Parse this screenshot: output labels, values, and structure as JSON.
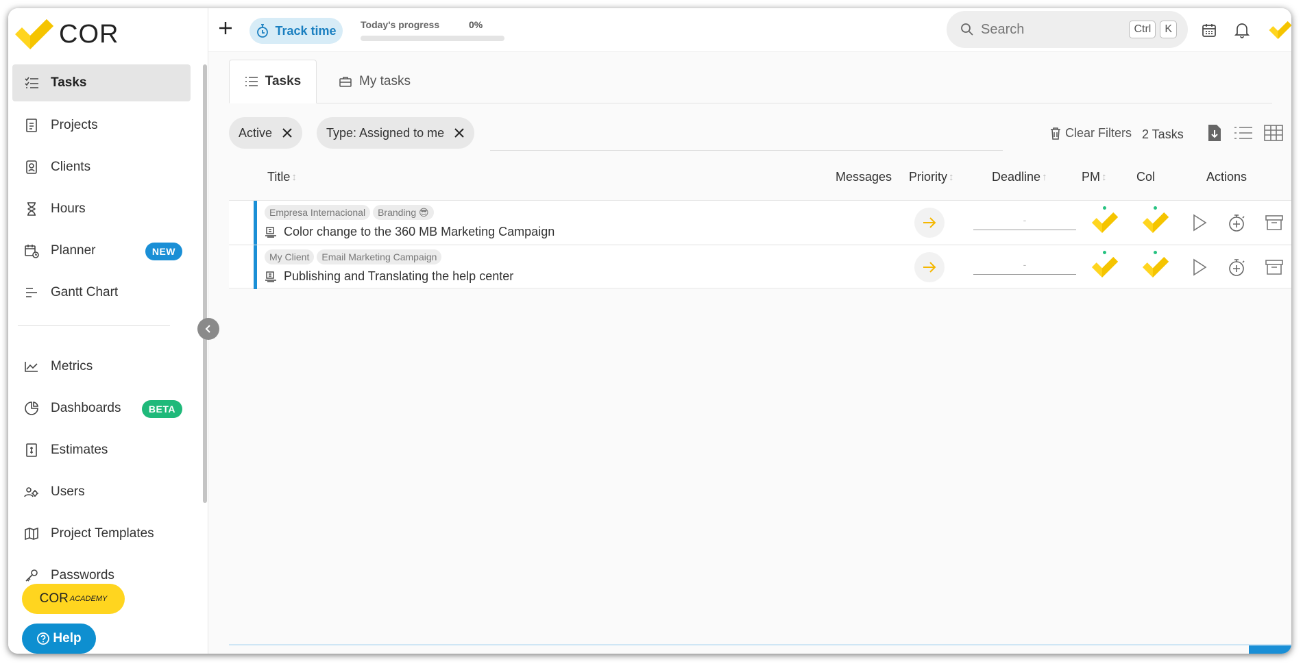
{
  "app": {
    "logo_text": "COR",
    "brand_color": "#ffd51f",
    "accent_color": "#1a8fd6"
  },
  "sidebar": {
    "items": [
      {
        "label": "Tasks",
        "icon": "tasks-icon",
        "active": true
      },
      {
        "label": "Projects",
        "icon": "projects-icon"
      },
      {
        "label": "Clients",
        "icon": "clients-icon"
      },
      {
        "label": "Hours",
        "icon": "hourglass-icon"
      },
      {
        "label": "Planner",
        "icon": "planner-icon",
        "badge": "NEW"
      },
      {
        "label": "Gantt Chart",
        "icon": "gantt-icon"
      },
      {
        "label": "Metrics",
        "icon": "metrics-icon"
      },
      {
        "label": "Dashboards",
        "icon": "dashboards-icon",
        "badge": "BETA"
      },
      {
        "label": "Estimates",
        "icon": "estimates-icon"
      },
      {
        "label": "Users",
        "icon": "users-icon"
      },
      {
        "label": "Project Templates",
        "icon": "map-icon"
      },
      {
        "label": "Passwords",
        "icon": "key-icon"
      }
    ],
    "academy_label": "COR",
    "academy_sub": "ACADEMY",
    "help_label": "Help"
  },
  "topbar": {
    "track_time": "Track time",
    "progress_label": "Today's progress",
    "progress_value": "0%",
    "progress_fraction": 0,
    "search_placeholder": "Search",
    "shortcut_ctrl": "Ctrl",
    "shortcut_k": "K"
  },
  "tabs": [
    {
      "label": "Tasks",
      "active": true
    },
    {
      "label": "My tasks"
    }
  ],
  "filters": {
    "chips": [
      "Active",
      "Type: Assigned to me"
    ],
    "clear_label": "Clear Filters",
    "count_label": "2 Tasks"
  },
  "table": {
    "headers": {
      "title": "Title",
      "messages": "Messages",
      "priority": "Priority",
      "deadline": "Deadline",
      "pm": "PM",
      "col": "Col",
      "actions": "Actions"
    },
    "rows": [
      {
        "tags": [
          "Empresa Internacional",
          "Branding 😎"
        ],
        "title": "Color change to the 360 MB Marketing Campaign",
        "deadline": "-"
      },
      {
        "tags": [
          "My Client",
          "Email Marketing Campaign"
        ],
        "title": "Publishing and Translating the help center",
        "deadline": "-"
      }
    ]
  }
}
